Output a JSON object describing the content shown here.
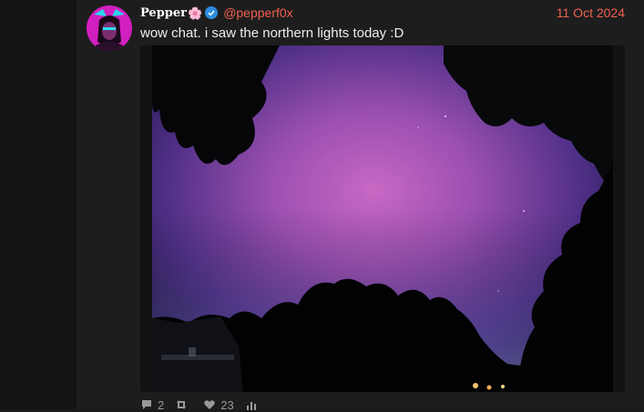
{
  "post": {
    "author": {
      "display_name": "Pepper",
      "name_emoji": "🌸",
      "handle": "@pepperf0x",
      "verified": true,
      "avatar_icon": "avatar-image"
    },
    "date": "11 Oct 2024",
    "text": "wow chat. i saw the northern lights today :D",
    "media": {
      "type": "photo",
      "subject": "northern lights"
    },
    "stats": {
      "replies": "2",
      "reposts": "",
      "likes": "23",
      "views": ""
    }
  },
  "colors": {
    "accent": "#f0614f",
    "verified": "#2f8de0",
    "background": "#1a1a1a"
  }
}
